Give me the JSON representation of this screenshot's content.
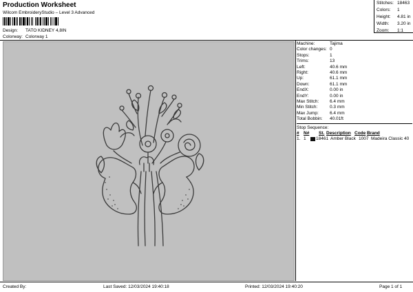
{
  "header": {
    "title": "Production Worksheet",
    "subtitle": "Wilcom EmbroideryStudio – Level 3 Advanced"
  },
  "meta": {
    "design_label": "Design:",
    "design_value": "TATO KIDNEY 4,8IN",
    "colorway_label": "Colorway:",
    "colorway_value": "Colorway 1"
  },
  "stats": [
    {
      "label": "Stitches:",
      "value": "18463"
    },
    {
      "label": "Colors:",
      "value": "1"
    },
    {
      "label": "Height:",
      "value": "4.81 in"
    },
    {
      "label": "Width:",
      "value": "3.20 in"
    },
    {
      "label": "Zoom:",
      "value": "1:1"
    }
  ],
  "machine_info": [
    {
      "label": "Machine:",
      "value": "Tajima"
    },
    {
      "label": "Color changes:",
      "value": "0"
    },
    {
      "label": "Stops:",
      "value": "1"
    },
    {
      "label": "Trims:",
      "value": "13"
    },
    {
      "label": "Left:",
      "value": "40.6 mm"
    },
    {
      "label": "Right:",
      "value": "40.6 mm"
    },
    {
      "label": "Up:",
      "value": "61.1 mm"
    },
    {
      "label": "Down:",
      "value": "61.1 mm"
    },
    {
      "label": "EndX:",
      "value": "0.00 in"
    },
    {
      "label": "EndY:",
      "value": "0.00 in"
    },
    {
      "label": "Max Stitch:",
      "value": "6.4 mm"
    },
    {
      "label": "Min Stitch:",
      "value": "0.3 mm"
    },
    {
      "label": "Max Jump:",
      "value": "6.4 mm"
    },
    {
      "label": "Total Bobbin:",
      "value": "40.01ft"
    }
  ],
  "stop_sequence": {
    "title": "Stop Sequence:",
    "headers": [
      "#",
      "N#",
      "St.",
      "Description",
      "Code",
      "Brand"
    ],
    "rows": [
      {
        "num": "1.",
        "n": "1",
        "swatch": "#111111",
        "st": "18461",
        "description": "Amber Black",
        "code": "1007",
        "brand": "Madeira Classic 40"
      }
    ]
  },
  "footer": {
    "created_by": "Created By:",
    "last_saved": "Last Saved: 12/03/2024 19:40:18",
    "printed": "Printed: 12/03/2024 19:40:20",
    "page": "Page 1 of 1"
  },
  "colors": {
    "canvas_bg": "#c0c0c0",
    "stitch": "#3a3a3a"
  }
}
